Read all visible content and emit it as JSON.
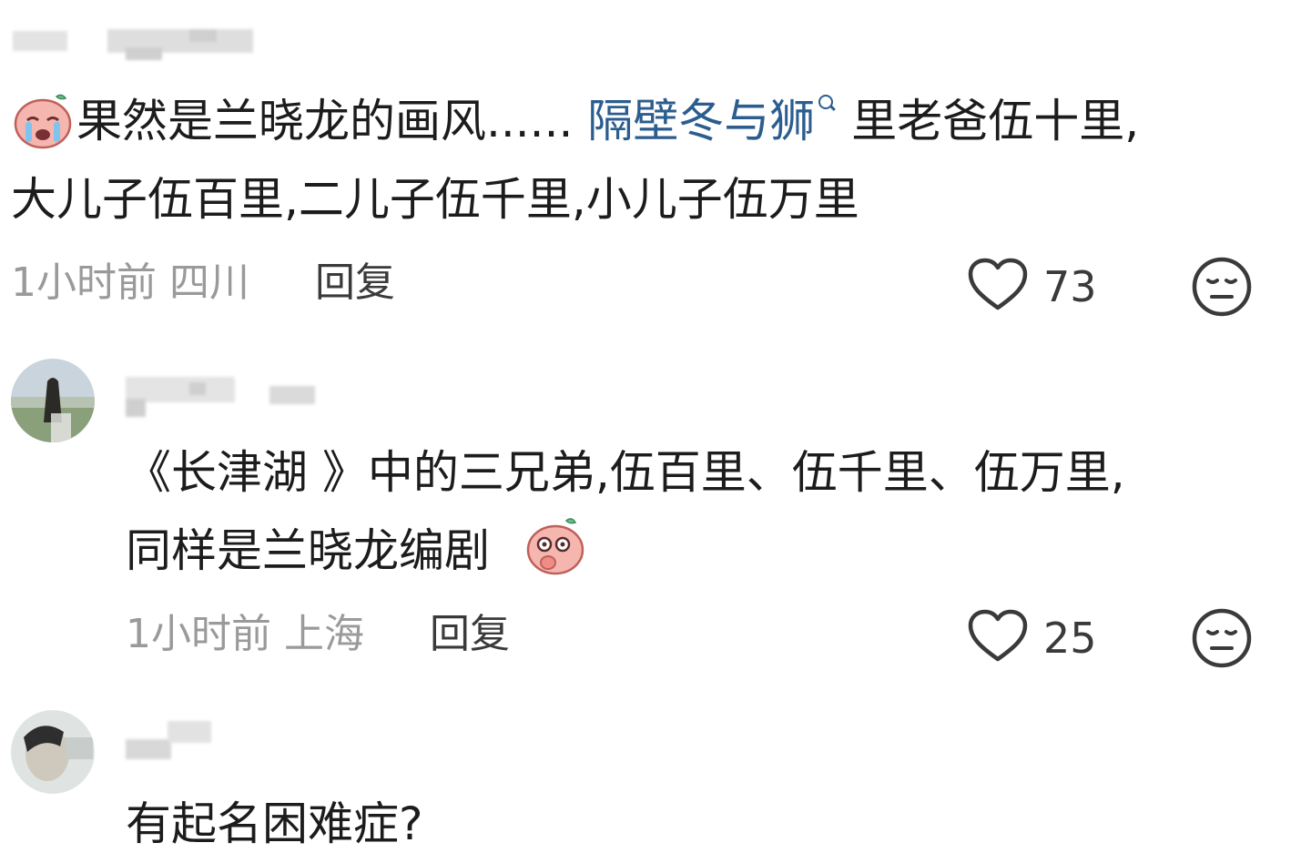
{
  "comments": [
    {
      "text_before_link": "果然是兰晓龙的画风...... ",
      "topic_link": "隔壁冬与狮",
      "text_after_link": "里老爸伍十里,",
      "line2": "大儿子伍百里,二儿子伍千里,小儿子伍万里",
      "time": "1小时前",
      "location": "四川",
      "reply_label": "回复",
      "likes": "73",
      "emoji_name": "crying-peach-emoji"
    },
    {
      "line1": "《长津湖 》中的三兄弟,伍百里、伍千里、伍万里,",
      "line2": "同样是兰晓龙编剧",
      "time": "1小时前",
      "location": "上海",
      "reply_label": "回复",
      "likes": "25",
      "emoji_name": "shocked-peach-emoji"
    },
    {
      "line1": "有起名困难症?"
    }
  ],
  "colors": {
    "text": "#1c1c1c",
    "meta": "#9a9a9a",
    "link": "#2b5d8f",
    "icon": "#3a3a3a"
  },
  "icons": {
    "like": "heart-icon",
    "dislike": "meh-face-icon",
    "search": "search-icon"
  }
}
